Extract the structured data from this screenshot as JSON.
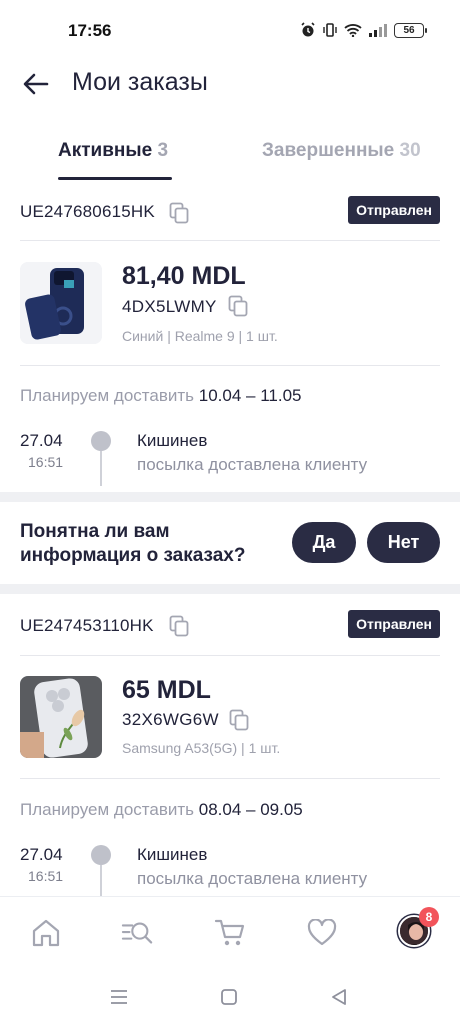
{
  "status_bar": {
    "time": "17:56",
    "battery": "56"
  },
  "header": {
    "title": "Мои заказы"
  },
  "tabs": [
    {
      "label": "Активные",
      "count": "3"
    },
    {
      "label": "Завершенные",
      "count": "30"
    }
  ],
  "orders": [
    {
      "tracking": "UE247680615HK",
      "status": "Отправлен",
      "price": "81,40 MDL",
      "sku": "4DX5LWMY",
      "meta": "Синий | Realme 9 | 1 шт.",
      "plan_label": "Планируем доставить",
      "plan_dates": "10.04 – 11.05",
      "event": {
        "date": "27.04",
        "time": "16:51",
        "city": "Кишинев",
        "status": "посылка доставлена клиенту"
      }
    },
    {
      "tracking": "UE247453110HK",
      "status": "Отправлен",
      "price": "65 MDL",
      "sku": "32X6WG6W",
      "meta": "Samsung A53(5G) | 1 шт.",
      "plan_label": "Планируем доставить",
      "plan_dates": "08.04 – 09.05",
      "event": {
        "date": "27.04",
        "time": "16:51",
        "city": "Кишинев",
        "status": "посылка доставлена клиенту"
      }
    }
  ],
  "feedback": {
    "question": "Понятна ли вам информация о заказах?",
    "yes": "Да",
    "no": "Нет"
  },
  "bottom_nav": {
    "items": [
      "home-icon",
      "search-catalog-icon",
      "cart-icon",
      "heart-icon",
      "avatar"
    ],
    "profile_badge": "8"
  },
  "colors": {
    "primary": "#2a2c44",
    "badge": "#f2545b",
    "muted": "#a4a6b2"
  }
}
